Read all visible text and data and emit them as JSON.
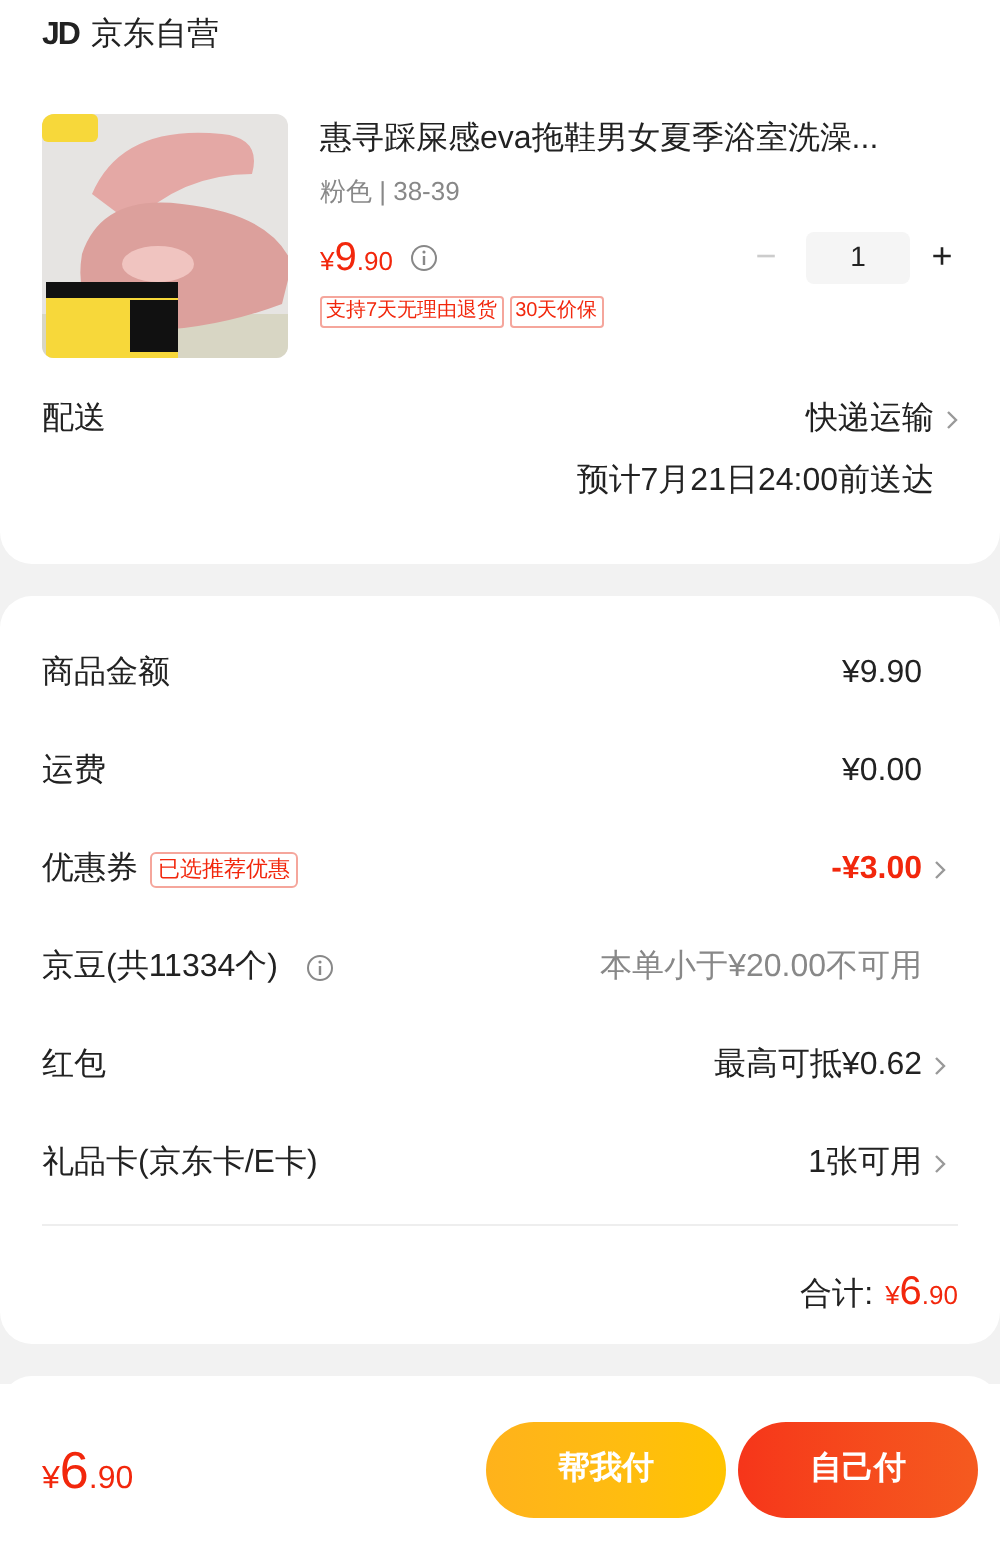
{
  "shop": {
    "logo": "JD",
    "name": "京东自营"
  },
  "product": {
    "kind": "picture",
    "title": "惠寻踩屎感eva拖鞋男女夏季浴室洗澡...",
    "spec": "粉色 | 38-39",
    "price_symbol": "¥",
    "price_int": "9",
    "price_dec": ".90",
    "minus_label": "−",
    "quantity": "1",
    "plus_label": "+",
    "minus_disabled": true,
    "tags": [
      "支持7天无理由退货",
      "30天价保"
    ]
  },
  "delivery": {
    "label": "配送",
    "method": "快递运输",
    "eta": "预计7月21日24:00前送达"
  },
  "summary": [
    {
      "label": "商品金额",
      "value": "¥9.90",
      "kind": "normal",
      "arrow": false,
      "info": false
    },
    {
      "label": "运费",
      "value": "¥0.00",
      "kind": "normal",
      "arrow": false,
      "info": false
    },
    {
      "label": "优惠券",
      "badge": "已选推荐优惠",
      "value": "-¥3.00",
      "kind": "discount",
      "arrow": true,
      "info": false
    },
    {
      "label": "京豆(共11334个)",
      "value": "本单小于¥20.00不可用",
      "kind": "muted",
      "arrow": false,
      "info": true
    },
    {
      "label": "红包",
      "value": "最高可抵¥0.62",
      "kind": "normal",
      "arrow": true,
      "info": false
    },
    {
      "label": "礼品卡(京东卡/E卡)",
      "value": "1张可用",
      "kind": "normal",
      "arrow": true,
      "info": false
    }
  ],
  "total": {
    "label": "合计:",
    "symbol": "¥",
    "int": "6",
    "dec": ".90"
  },
  "bottom_bar": {
    "symbol": "¥",
    "int": "6",
    "dec": ".90",
    "buttons": [
      {
        "label": "帮我付",
        "kind": "secondary"
      },
      {
        "label": "自己付",
        "kind": "primary"
      }
    ]
  }
}
